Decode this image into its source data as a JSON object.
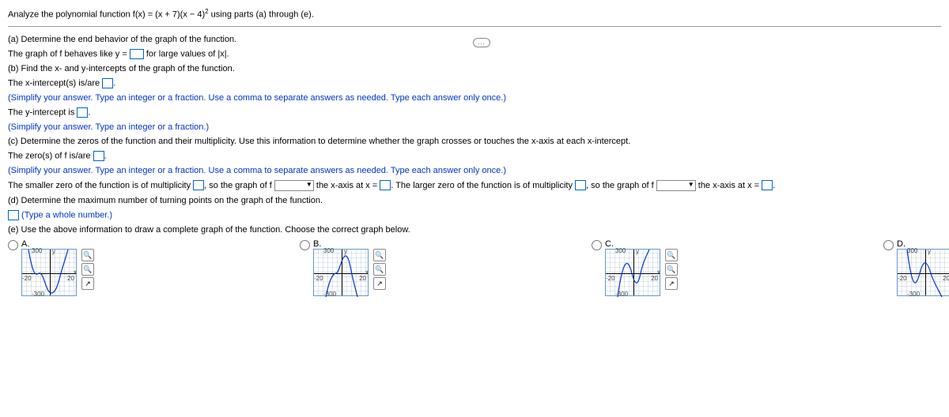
{
  "prompt": {
    "pre": "Analyze the polynomial function f(x) = (x + 7)(x − 4)",
    "exp": "2",
    "post": " using parts (a) through (e)."
  },
  "ellipsis": "…",
  "a": {
    "q": "(a) Determine the end behavior of the graph of the function.",
    "l1a": "The graph of f behaves like y = ",
    "l1b": " for large values of |x|."
  },
  "b": {
    "q": "(b) Find the x- and y-intercepts of the graph of the function.",
    "x1": "The x-intercept(s) is/are ",
    "x2": ".",
    "xhint": "(Simplify your answer. Type an integer or a fraction. Use a comma to separate answers as needed. Type each answer only once.)",
    "y1": "The y-intercept is ",
    "y2": ".",
    "yhint": "(Simplify your answer. Type an integer or a fraction.)"
  },
  "c": {
    "q": "(c) Determine the zeros of the function and their multiplicity. Use this information to determine whether the graph crosses or touches the x-axis at each x-intercept.",
    "z1": "The zero(s) of f is/are ",
    "z2": ".",
    "zhint": "(Simplify your answer. Type an integer or a fraction. Use a comma to separate answers as needed. Type each answer only once.)",
    "m1": "The smaller zero of the function is of multiplicity ",
    "m2": ", so the graph of f ",
    "m3": " the x-axis at x = ",
    "m4": ". The larger zero of the function is of multiplicity ",
    "m5": ", so the graph of f ",
    "m6": " the x-axis at x = ",
    "m7": "."
  },
  "d": {
    "q": "(d) Determine the maximum number of turning points on the graph of the function.",
    "hint": " (Type a whole number.)"
  },
  "e": {
    "q": "(e) Use the above information to draw a complete graph of the function. Choose the correct graph below."
  },
  "opts": {
    "a": "A.",
    "b": "B.",
    "c": "C.",
    "d": "D."
  },
  "glabels": {
    "top": "300",
    "bot": "-300",
    "left": "-20",
    "right": "20",
    "yl": "y",
    "xl": "x"
  },
  "tools": {
    "zoomin": "🔍",
    "zoomout": "🔍",
    "expand": "↗"
  }
}
